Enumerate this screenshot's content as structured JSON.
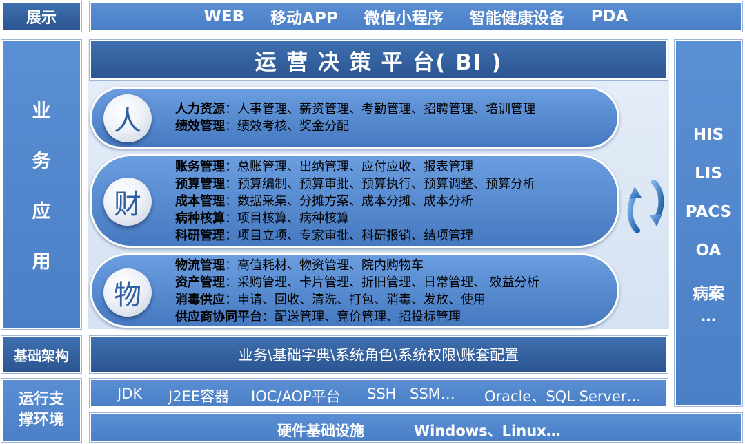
{
  "top": {
    "label": "展示",
    "items": [
      "WEB",
      "移动APP",
      "微信小程序",
      "智能健康设备",
      "PDA"
    ]
  },
  "business": {
    "label_chars": [
      "业",
      "务",
      "应",
      "用"
    ]
  },
  "bi": {
    "title": "运 营 决 策 平 台( BI )"
  },
  "groups": [
    {
      "icon_char": "人",
      "rows": [
        {
          "head": "人力资源",
          "items": "：人事管理、薪资管理、考勤管理、招聘管理、培训管理"
        },
        {
          "head": "绩效管理",
          "items": "：绩效考核、奖金分配"
        }
      ]
    },
    {
      "icon_char": "财",
      "rows": [
        {
          "head": "账务管理",
          "items": "：总账管理、出纳管理、应付应收、报表管理"
        },
        {
          "head": "预算管理",
          "items": "：预算编制、预算审批、预算执行、预算调整、预算分析"
        },
        {
          "head": "成本管理",
          "items": "：数据采集、分摊方案、成本分摊、成本分析"
        },
        {
          "head": "病种核算",
          "items": "：项目核算、病种核算"
        },
        {
          "head": "科研管理",
          "items": "：项目立项、专家审批、科研报销、结项管理"
        }
      ]
    },
    {
      "icon_char": "物",
      "rows": [
        {
          "head": "物流管理",
          "items": "：高值耗材、物资管理、院内购物车"
        },
        {
          "head": "资产管理",
          "items": "：采购管理、卡片管理、折旧管理、日常管理、 效益分析"
        },
        {
          "head": "消毒供应",
          "items": "：申请、回收、清洗、打包、消毒、发放、使用"
        },
        {
          "head": "供应商协同平台",
          "items": "：配送管理、竞价管理、招投标管理"
        }
      ]
    }
  ],
  "right": {
    "items": [
      "HIS",
      "LIS",
      "PACS",
      "OA",
      "病案",
      "…"
    ]
  },
  "infra": {
    "label": "基础架构",
    "content": "业务\\基础字典\\系统角色\\系统权限\\账套配置"
  },
  "runtime": {
    "label_lines": [
      "运行支",
      "撑环境"
    ],
    "software": [
      "JDK",
      "J2EE容器",
      "IOC/AOP平台",
      "SSH",
      "SSM…",
      "Oracle、SQL Server…"
    ],
    "hardware_label": "硬件基础设施",
    "hardware_os": "Windows、Linux…"
  },
  "colors": {
    "dark": "#2b5592",
    "light": "#4b7fc6",
    "pill": "#5a8ed6",
    "cycle_arrow": "#2e6db8"
  },
  "icons": {
    "cycle": "cycle-arrows-icon"
  }
}
